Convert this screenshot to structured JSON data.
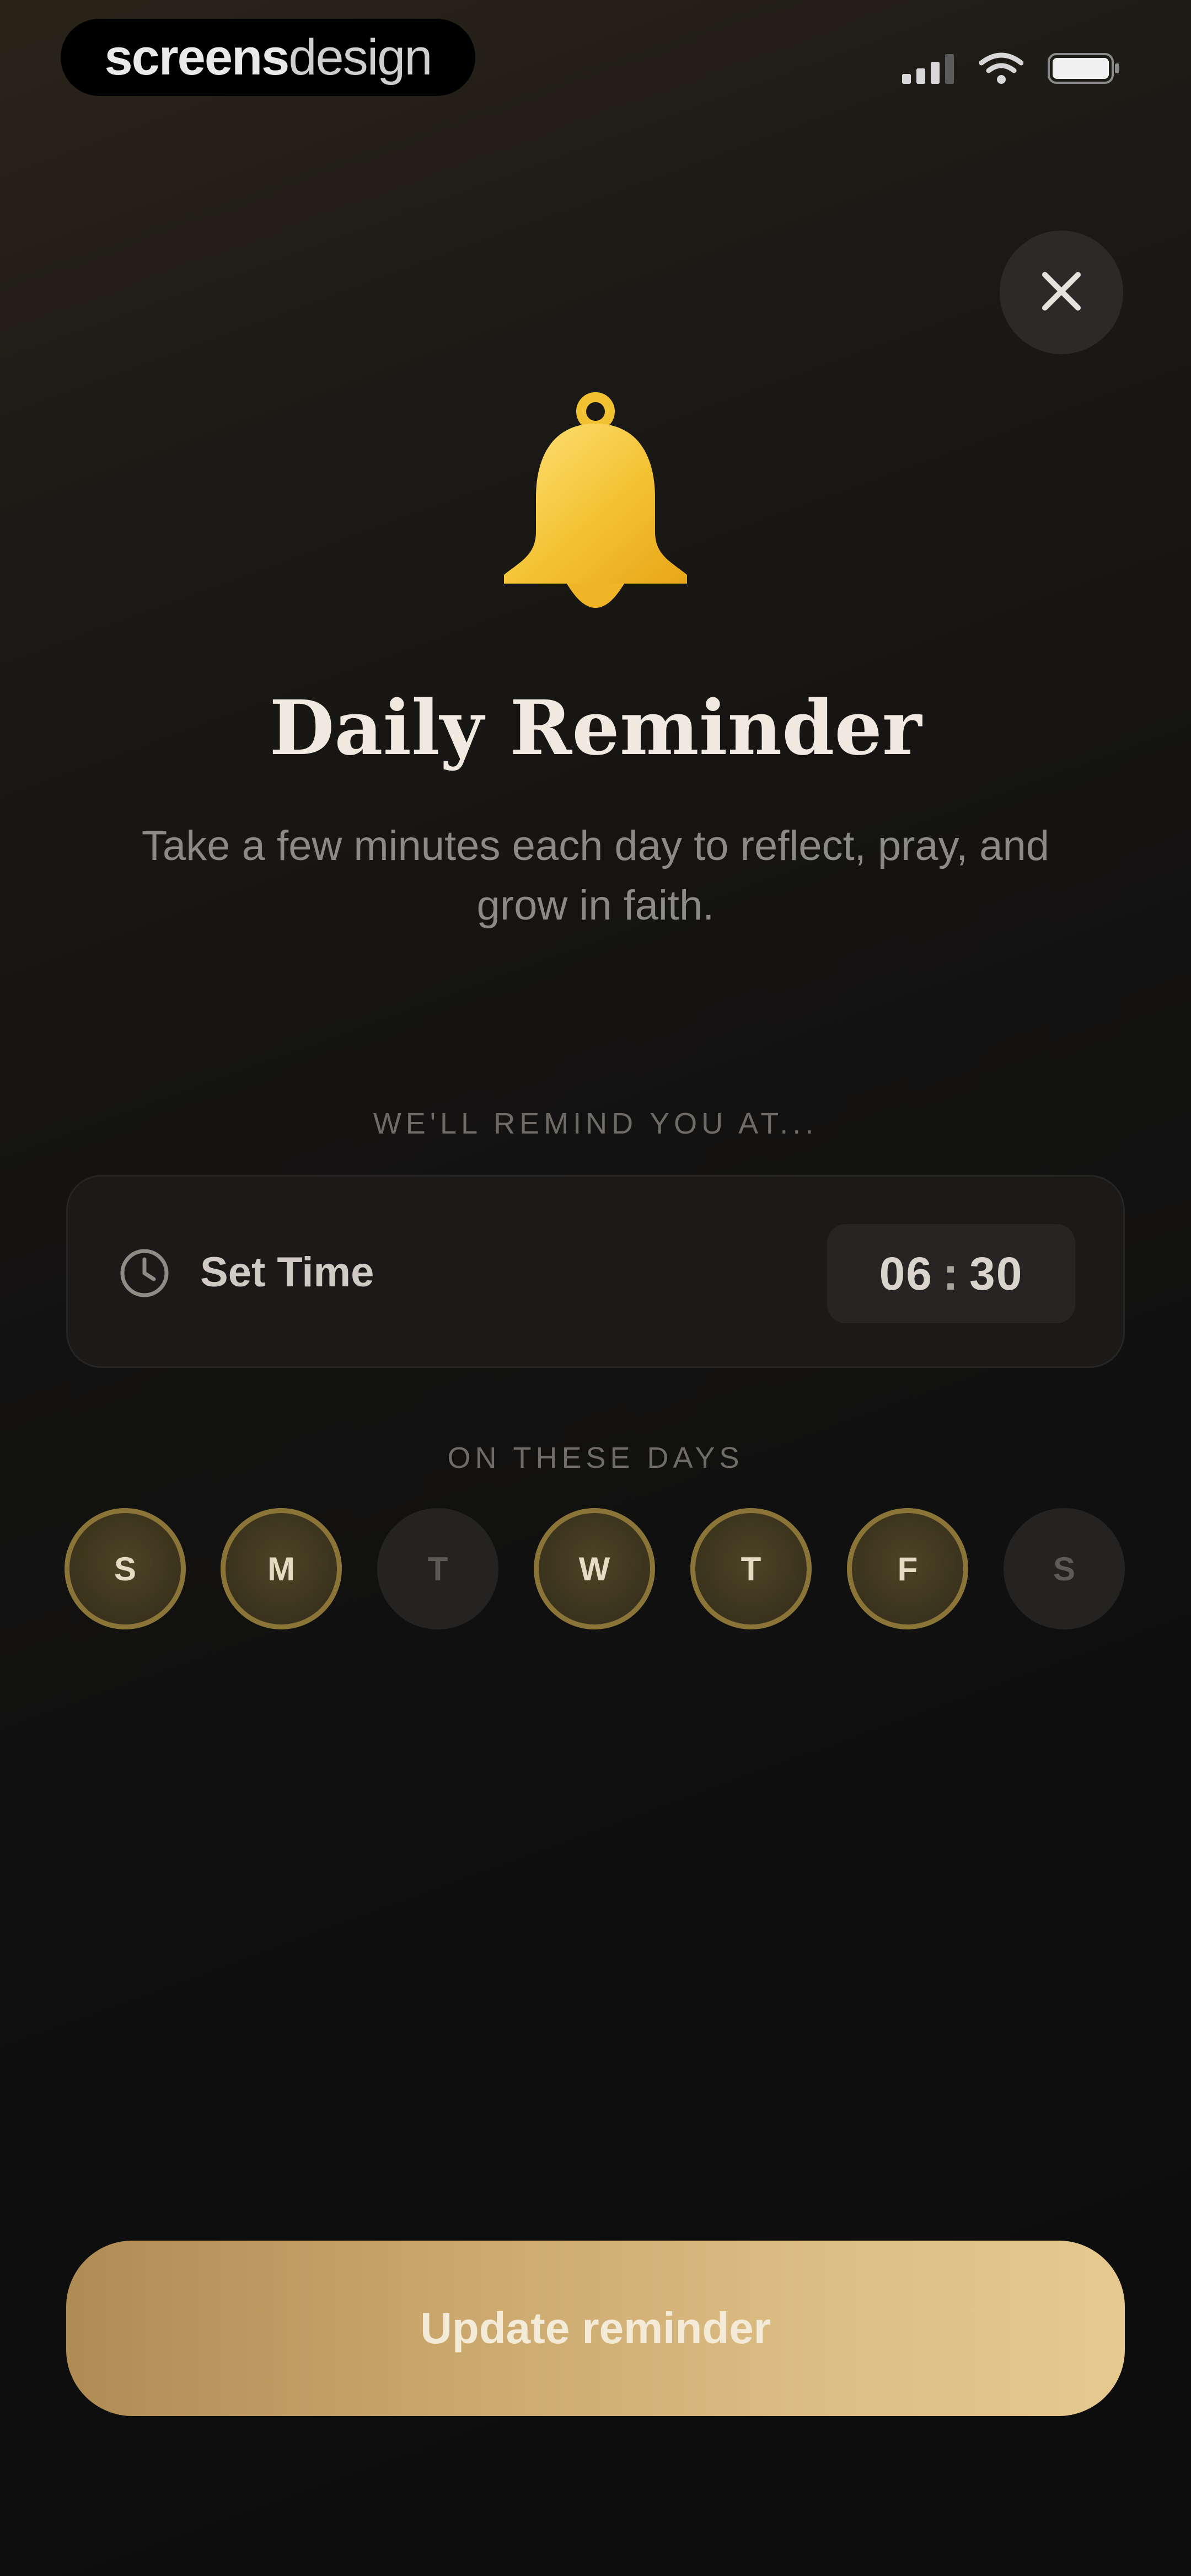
{
  "watermark": {
    "part1": "screens",
    "part2": "design"
  },
  "title": "Daily Reminder",
  "subtitle": "Take a few minutes each day to reflect, pray, and grow in faith.",
  "remind_label": "WE'LL REMIND YOU AT...",
  "time": {
    "label": "Set Time",
    "hours": "06",
    "separator": ":",
    "minutes": "30"
  },
  "days_label": "ON THESE DAYS",
  "days": [
    {
      "label": "S",
      "selected": true
    },
    {
      "label": "M",
      "selected": true
    },
    {
      "label": "T",
      "selected": false
    },
    {
      "label": "W",
      "selected": true
    },
    {
      "label": "T",
      "selected": true
    },
    {
      "label": "F",
      "selected": true
    },
    {
      "label": "S",
      "selected": false
    }
  ],
  "cta_label": "Update reminder",
  "icons": {
    "status": [
      "cellular-signal-icon",
      "wifi-icon",
      "battery-icon"
    ],
    "close": "close-icon",
    "bell": "bell-icon",
    "clock": "clock-icon"
  },
  "colors": {
    "accent_gold": "#d4b274",
    "bell_gold": "#f2c53a",
    "selected_ring": "#8a7437",
    "background": "#111111"
  }
}
